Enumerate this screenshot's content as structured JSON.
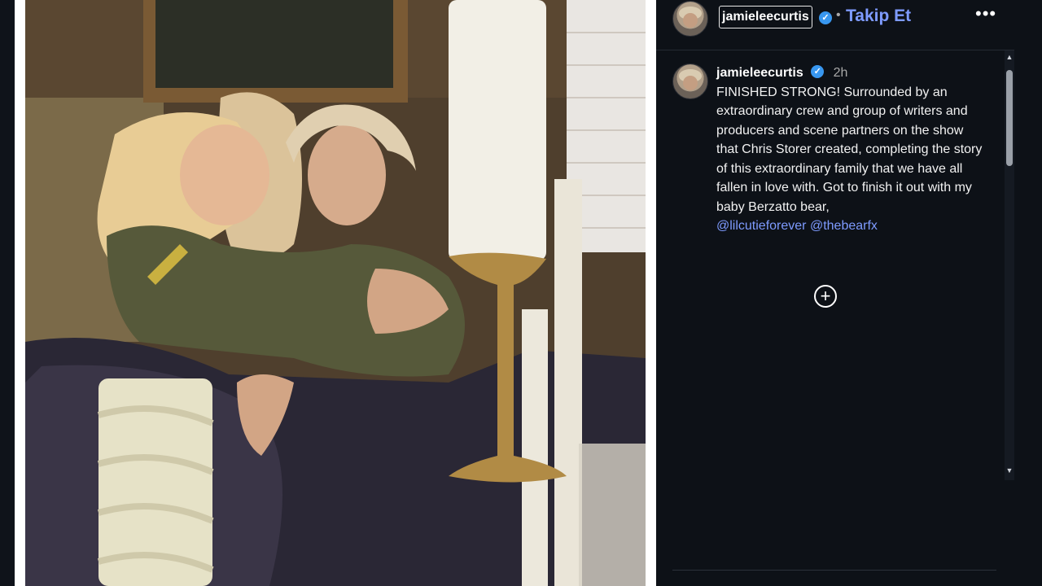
{
  "post": {
    "image_alt": "Two women embracing on a sofa beside candles",
    "username": "jamieleecurtis",
    "follow_label": "Takip Et",
    "separator": "•",
    "more_label": "•••",
    "verified_icon": "✓"
  },
  "caption": {
    "username": "jamieleecurtis",
    "time": "2h",
    "text": "FINISHED STRONG! Surrounded by an extraordinary crew and group of writers and producers and scene partners on the show that Chris Storer created, completing the story of this extraordinary family that we have all fallen in love with. Got to finish it out with my baby Berzatto bear,",
    "mentions": [
      "@lilcutieforever",
      "@thebearfx"
    ]
  },
  "actions": {
    "add_icon": "+"
  },
  "scroll": {
    "up": "▲",
    "down": "▼"
  },
  "colors": {
    "link": "#7e9bff",
    "verified": "#3897f0",
    "background": "#0d1117"
  }
}
